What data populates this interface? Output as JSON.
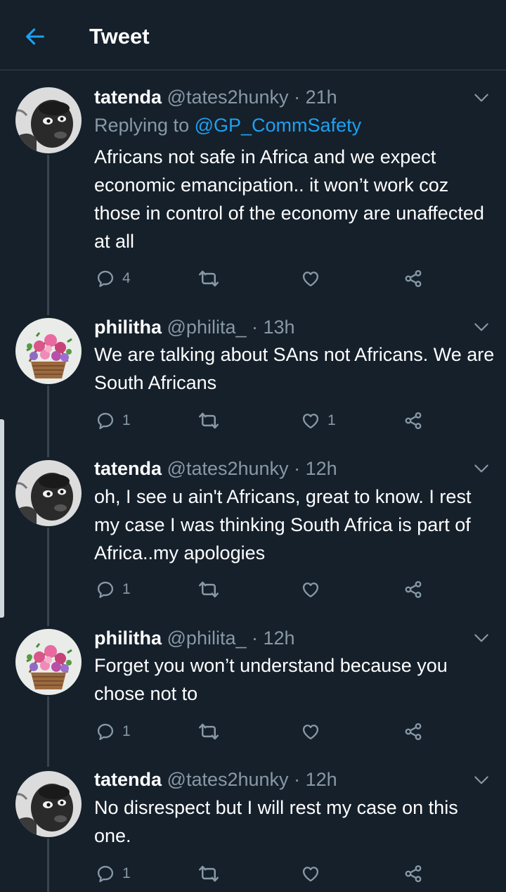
{
  "header": {
    "title": "Tweet",
    "back_icon": "arrow-left-icon"
  },
  "colors": {
    "accent": "#1da1f2",
    "background": "#15202b",
    "muted": "#8899a6",
    "divider": "#38444d"
  },
  "tweets": [
    {
      "name": "tatenda",
      "handle": "@tates2hunky",
      "time": "· 21h",
      "reply_prefix": "Replying to",
      "reply_handle": "@GP_CommSafety",
      "text": "Africans not safe in Africa and we expect economic emancipation.. it won’t work coz those in control of the economy are unaffected at all",
      "replies": "4",
      "retweets": "",
      "likes": ""
    },
    {
      "name": "philitha",
      "handle": "@philita_",
      "time": "· 13h",
      "text": "We are talking about SAns not Africans. We are South Africans",
      "replies": "1",
      "retweets": "",
      "likes": "1"
    },
    {
      "name": "tatenda",
      "handle": "@tates2hunky",
      "time": "· 12h",
      "text": "oh, I see u ain't Africans, great to know. I rest my case I was thinking South Africa is part of Africa..my apologies",
      "replies": "1",
      "retweets": "",
      "likes": ""
    },
    {
      "name": "philitha",
      "handle": "@philita_",
      "time": "· 12h",
      "text": "Forget you won’t understand because you chose not to",
      "replies": "1",
      "retweets": "",
      "likes": ""
    },
    {
      "name": "tatenda",
      "handle": "@tates2hunky",
      "time": "· 12h",
      "text": "No disrespect but I will rest my case on this one.",
      "replies": "1",
      "retweets": "",
      "likes": ""
    }
  ]
}
